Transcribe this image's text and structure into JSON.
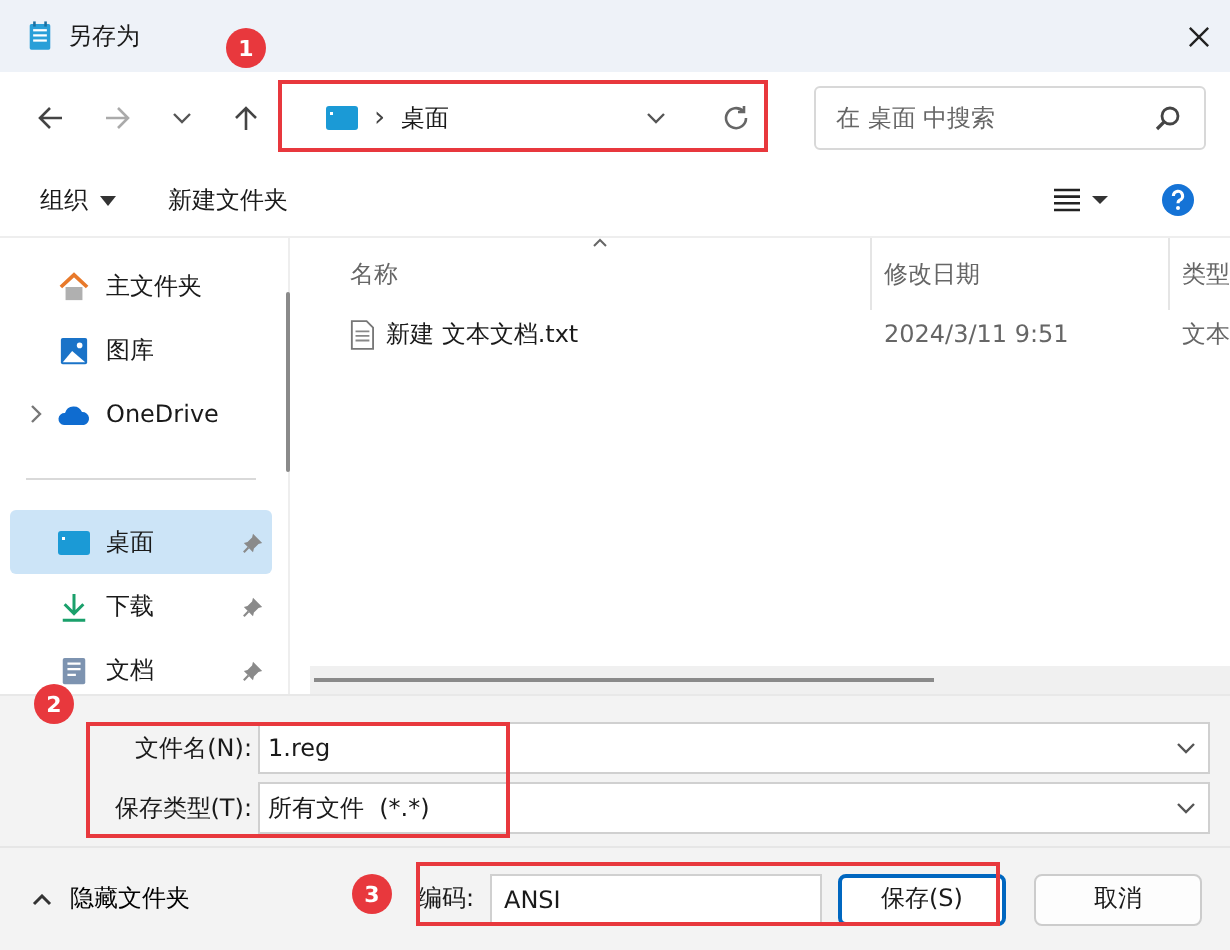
{
  "window": {
    "title": "另存为"
  },
  "nav": {
    "separator": "›",
    "path": "桌面",
    "search_placeholder": "在 桌面 中搜索"
  },
  "toolbar": {
    "organize": "组织",
    "new_folder": "新建文件夹"
  },
  "sidebar": {
    "sections": [
      {
        "items": [
          {
            "label": "主文件夹",
            "kind": "home",
            "selected": false,
            "pinned": false,
            "expandable": false
          },
          {
            "label": "图库",
            "kind": "gallery",
            "selected": false,
            "pinned": false,
            "expandable": false
          },
          {
            "label": "OneDrive",
            "kind": "cloud",
            "selected": false,
            "pinned": false,
            "expandable": true
          }
        ]
      },
      {
        "items": [
          {
            "label": "桌面",
            "kind": "desktop",
            "selected": true,
            "pinned": true,
            "expandable": false
          },
          {
            "label": "下载",
            "kind": "download",
            "selected": false,
            "pinned": true,
            "expandable": false
          },
          {
            "label": "文档",
            "kind": "document",
            "selected": false,
            "pinned": true,
            "expandable": false
          }
        ]
      }
    ]
  },
  "columns": [
    {
      "label": "名称",
      "sorted": true
    },
    {
      "label": "修改日期",
      "sorted": false
    },
    {
      "label": "类型",
      "sorted": false
    }
  ],
  "rows": [
    {
      "name": "新建 文本文档.txt",
      "date": "2024/3/11 9:51",
      "type": "文本"
    }
  ],
  "form": {
    "filename_label": "文件名(N):",
    "filename": "1.reg",
    "type_label": "保存类型(T):",
    "type": "所有文件  (*.*)",
    "encoding_label": "编码:",
    "encoding": "ANSI"
  },
  "hide_folders": "隐藏文件夹",
  "buttons": [
    "保存(S)",
    "取消"
  ],
  "annotations": [
    {
      "label": "1"
    },
    {
      "label": "2"
    },
    {
      "label": "3"
    }
  ]
}
